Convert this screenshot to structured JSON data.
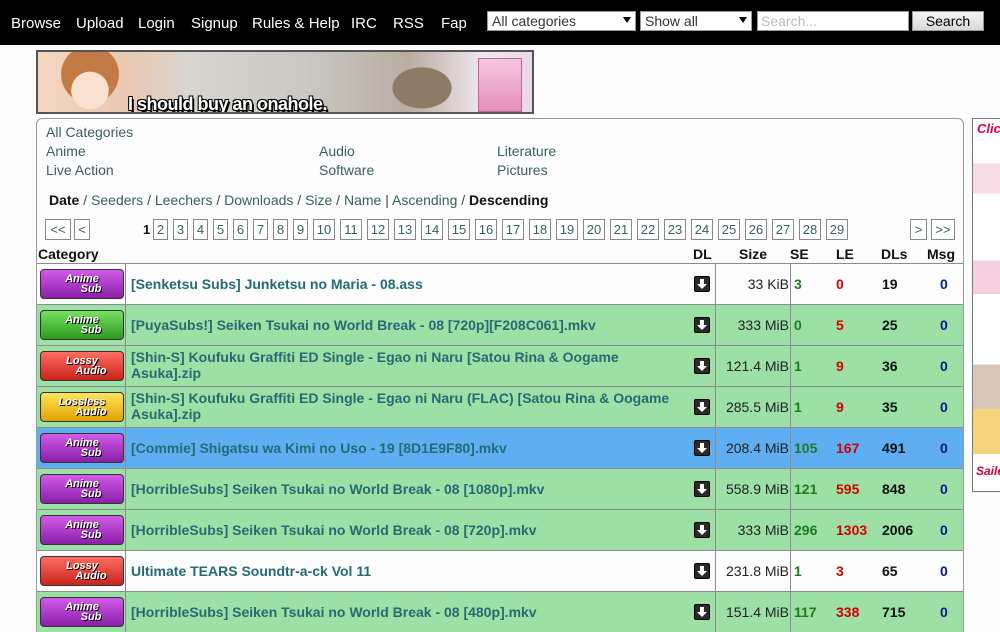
{
  "nav": {
    "links": [
      "Browse",
      "Upload",
      "Login",
      "Signup",
      "Rules & Help",
      "IRC",
      "RSS",
      "Fap"
    ],
    "category_select": "All categories",
    "filter_select": "Show all",
    "search_placeholder": "Search...",
    "search_button": "Search"
  },
  "banner": {
    "caption": "I should buy an onahole."
  },
  "side_ad": {
    "top_text": "Clic",
    "bottom_text": "Saile Proj"
  },
  "categories": {
    "all": "All Categories",
    "items": [
      "Anime",
      "Audio",
      "Literature",
      "Live Action",
      "Software",
      "Pictures"
    ]
  },
  "sort": {
    "options": [
      "Date",
      "Seeders",
      "Leechers",
      "Downloads",
      "Size",
      "Name"
    ],
    "order": [
      "Ascending",
      "Descending"
    ],
    "active_option": "Date",
    "active_order": "Descending"
  },
  "pagination": {
    "first": "<<",
    "prev": "<",
    "next": ">",
    "last": ">>",
    "current": "1",
    "pages": [
      "2",
      "3",
      "4",
      "5",
      "6",
      "7",
      "8",
      "9",
      "10",
      "11",
      "12",
      "13",
      "14",
      "15",
      "16",
      "17",
      "18",
      "19",
      "20",
      "21",
      "22",
      "23",
      "24",
      "25",
      "26",
      "27",
      "28",
      "29"
    ]
  },
  "table": {
    "headers": {
      "category": "Category",
      "dl": "DL",
      "size": "Size",
      "se": "SE",
      "le": "LE",
      "dls": "DLs",
      "msg": "Msg"
    },
    "rows": [
      {
        "badge": [
          "Anime",
          "Sub"
        ],
        "badge_type": "anime",
        "name": "[Senketsu Subs] Junketsu no Maria - 08.ass",
        "size": "33 KiB",
        "se": "3",
        "le": "0",
        "dls": "19",
        "msg": "0",
        "status": "normal"
      },
      {
        "badge": [
          "Anime",
          "Sub"
        ],
        "badge_type": "anime-trusted",
        "name": "[PuyaSubs!] Seiken Tsukai no World Break - 08 [720p][F208C061].mkv",
        "size": "333 MiB",
        "se": "0",
        "le": "5",
        "dls": "25",
        "msg": "0",
        "status": "trusted"
      },
      {
        "badge": [
          "Lossy",
          "Audio"
        ],
        "badge_type": "lossy",
        "name": "[Shin-S] Koufuku Graffiti ED Single - Egao ni Naru [Satou Rina & Oogame Asuka].zip",
        "size": "121.4 MiB",
        "se": "1",
        "le": "9",
        "dls": "36",
        "msg": "0",
        "status": "trusted"
      },
      {
        "badge": [
          "Lossless",
          "Audio"
        ],
        "badge_type": "lossless",
        "name": "[Shin-S] Koufuku Graffiti ED Single - Egao ni Naru (FLAC) [Satou Rina & Oogame Asuka].zip",
        "size": "285.5 MiB",
        "se": "1",
        "le": "9",
        "dls": "35",
        "msg": "0",
        "status": "trusted"
      },
      {
        "badge": [
          "Anime",
          "Sub"
        ],
        "badge_type": "anime",
        "name": "[Commie] Shigatsu wa Kimi no Uso - 19 [8D1E9F80].mkv",
        "size": "208.4 MiB",
        "se": "105",
        "le": "167",
        "dls": "491",
        "msg": "0",
        "status": "aplus"
      },
      {
        "badge": [
          "Anime",
          "Sub"
        ],
        "badge_type": "anime",
        "name": "[HorribleSubs] Seiken Tsukai no World Break - 08 [1080p].mkv",
        "size": "558.9 MiB",
        "se": "121",
        "le": "595",
        "dls": "848",
        "msg": "0",
        "status": "trusted"
      },
      {
        "badge": [
          "Anime",
          "Sub"
        ],
        "badge_type": "anime",
        "name": "[HorribleSubs] Seiken Tsukai no World Break - 08 [720p].mkv",
        "size": "333 MiB",
        "se": "296",
        "le": "1303",
        "dls": "2006",
        "msg": "0",
        "status": "trusted"
      },
      {
        "badge": [
          "Lossy",
          "Audio"
        ],
        "badge_type": "lossy",
        "name": "Ultimate TEARS Soundtr-a-ck Vol 11",
        "size": "231.8 MiB",
        "se": "1",
        "le": "3",
        "dls": "65",
        "msg": "0",
        "status": "normal"
      },
      {
        "badge": [
          "Anime",
          "Sub"
        ],
        "badge_type": "anime",
        "name": "[HorribleSubs] Seiken Tsukai no World Break - 08 [480p].mkv",
        "size": "151.4 MiB",
        "se": "117",
        "le": "338",
        "dls": "715",
        "msg": "0",
        "status": "trusted"
      }
    ]
  },
  "colors": {
    "trusted_row": "#9ce0a6",
    "aplus_row": "#5faef2",
    "link": "#376060",
    "seeders": "#217a21",
    "leechers": "#d40000"
  }
}
